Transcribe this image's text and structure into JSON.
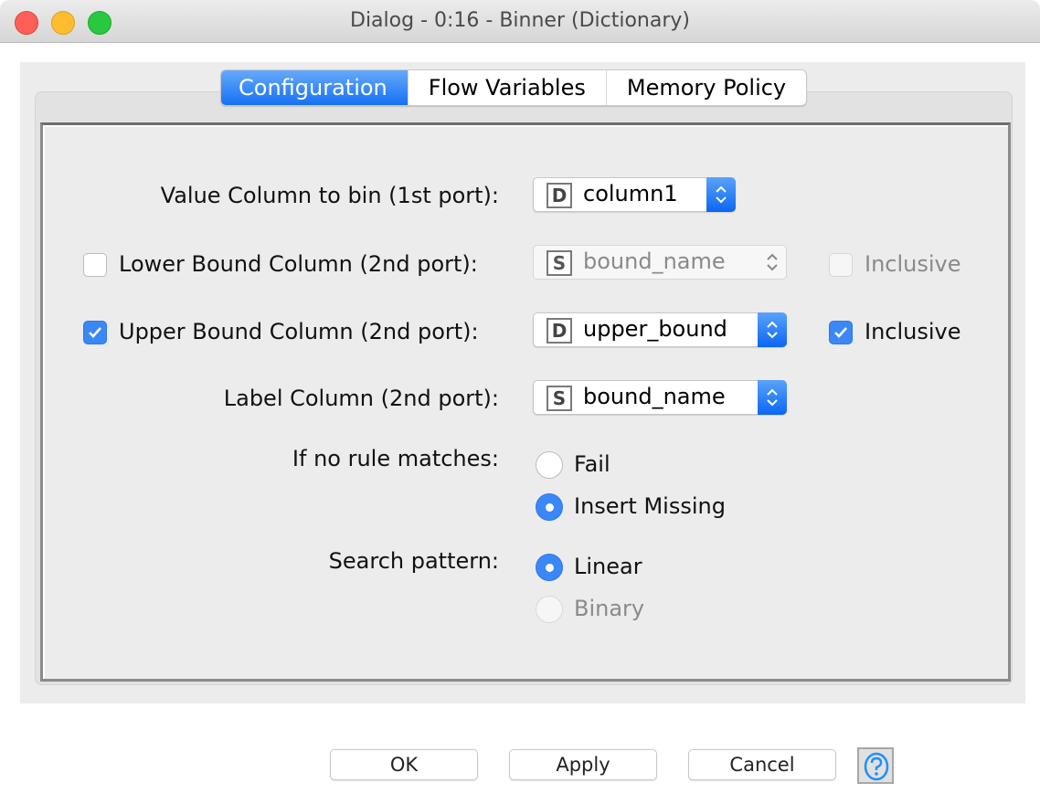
{
  "window": {
    "title": "Dialog - 0:16 - Binner (Dictionary)"
  },
  "tabs": [
    {
      "label": "Configuration",
      "active": true
    },
    {
      "label": "Flow Variables",
      "active": false
    },
    {
      "label": "Memory Policy",
      "active": false
    }
  ],
  "form": {
    "value_column": {
      "label": "Value Column to bin (1st port):",
      "type_badge": "D",
      "value": "column1"
    },
    "lower_bound": {
      "label": "Lower Bound Column (2nd port):",
      "checked": false,
      "type_badge": "S",
      "value": "bound_name",
      "enabled": false,
      "inclusive_label": "Inclusive",
      "inclusive_checked": false
    },
    "upper_bound": {
      "label": "Upper Bound Column (2nd port):",
      "checked": true,
      "type_badge": "D",
      "value": "upper_bound",
      "enabled": true,
      "inclusive_label": "Inclusive",
      "inclusive_checked": true
    },
    "label_column": {
      "label": "Label Column (2nd port):",
      "type_badge": "S",
      "value": "bound_name"
    },
    "no_rule_matches": {
      "label": "If no rule matches:",
      "options": [
        {
          "label": "Fail",
          "selected": false,
          "enabled": true
        },
        {
          "label": "Insert Missing",
          "selected": true,
          "enabled": true
        }
      ]
    },
    "search_pattern": {
      "label": "Search pattern:",
      "options": [
        {
          "label": "Linear",
          "selected": true,
          "enabled": true
        },
        {
          "label": "Binary",
          "selected": false,
          "enabled": false
        }
      ]
    }
  },
  "buttons": {
    "ok": "OK",
    "apply": "Apply",
    "cancel": "Cancel",
    "help_icon": "help-question-icon"
  },
  "colors": {
    "accent": "#3b87f7",
    "tab_active": "#1571f3",
    "disabled_text": "#8a8a8a"
  }
}
